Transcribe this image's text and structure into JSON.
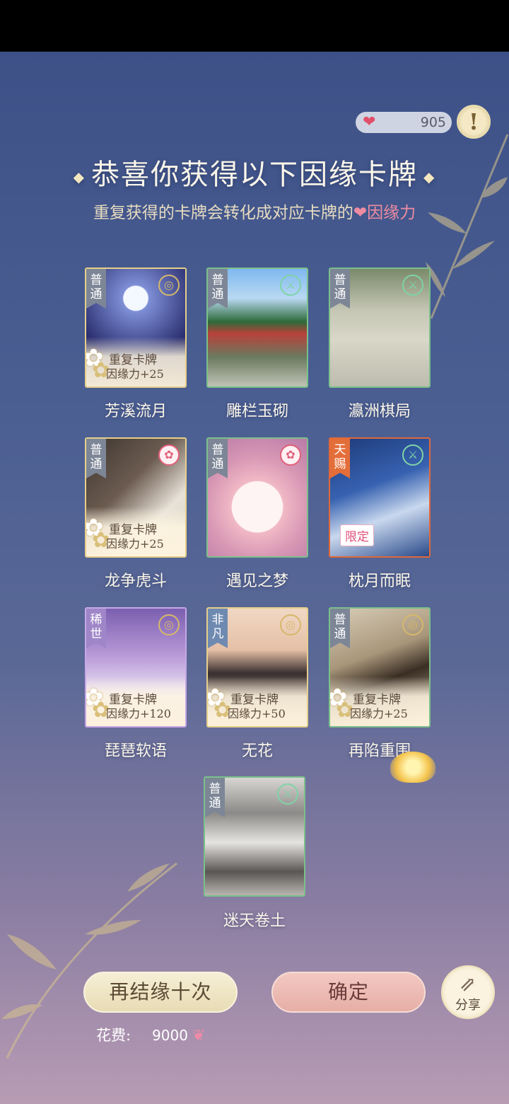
{
  "header": {
    "yinyuan_count": "905",
    "info_label": "!",
    "title": "恭喜你获得以下因缘卡牌",
    "subtitle_prefix": "重复获得的卡牌会转化成对应卡牌的",
    "subtitle_highlight": "因缘力"
  },
  "cards": [
    {
      "name": "芳溪流月",
      "rarity": "普通",
      "dup_label": "重复卡牌",
      "dup_value": "因缘力+25"
    },
    {
      "name": "雕栏玉砌",
      "rarity": "普通"
    },
    {
      "name": "瀛洲棋局",
      "rarity": "普通"
    },
    {
      "name": "龙争虎斗",
      "rarity": "普通",
      "dup_label": "重复卡牌",
      "dup_value": "因缘力+25"
    },
    {
      "name": "遇见之梦",
      "rarity": "普通"
    },
    {
      "name": "枕月而眠",
      "rarity": "天赐",
      "badge": "限定"
    },
    {
      "name": "琵琶软语",
      "rarity": "稀世",
      "dup_label": "重复卡牌",
      "dup_value": "因缘力+120"
    },
    {
      "name": "无花",
      "rarity": "非凡",
      "dup_label": "重复卡牌",
      "dup_value": "因缘力+50"
    },
    {
      "name": "再陷重围",
      "rarity": "普通",
      "dup_label": "重复卡牌",
      "dup_value": "因缘力+25"
    },
    {
      "name": "迷天卷土",
      "rarity": "普通"
    }
  ],
  "footer": {
    "again_label": "再结缘十次",
    "ok_label": "确定",
    "share_label": "分享",
    "cost_label": "花费:",
    "cost_value": "9000"
  },
  "icons": {
    "heart": "heart-icon",
    "info": "exclamation-icon",
    "share": "share-icon",
    "butterfly": "butterfly-icon"
  }
}
